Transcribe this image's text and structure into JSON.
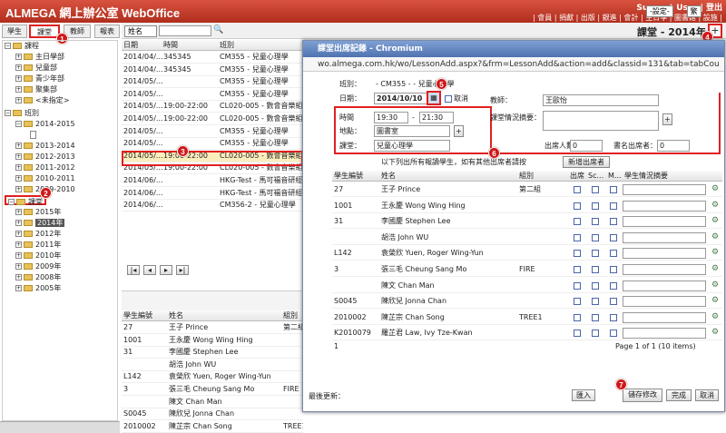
{
  "app": {
    "logo": "ALMEGA 網上辦公室 WebOffice"
  },
  "topbar": {
    "user": "Support User | 登出",
    "links": "| 會員 | 捐獻 | 出版 | 銀進 | 會計 | 主日學 | 圖書館 | 設施 |",
    "settings_select": "-設定-",
    "lang_select": "繁"
  },
  "left_tabs": [
    "學生",
    "課堂",
    "教師",
    "報表"
  ],
  "tree": {
    "items": [
      "課程",
      "主日學部",
      "兒童部",
      "青少年部",
      "聚集部",
      "<未指定>",
      "班別",
      "2014-2015",
      "2013-2014",
      "2012-2013",
      "2011-2012",
      "2010-2011",
      "2009-2010",
      "課堂",
      "2015年",
      "2014年",
      "2012年",
      "2011年",
      "2010年",
      "2009年",
      "2008年",
      "2005年"
    ]
  },
  "main": {
    "title": "課堂 - 2014年",
    "search_select": "姓名",
    "columns": [
      "日期",
      "時間",
      "班別"
    ],
    "rows": [
      [
        "2014/04/...",
        "345345",
        "CM355 - 兒童心理學"
      ],
      [
        "2014/04/...",
        "345345",
        "CM355 - 兒童心理學"
      ],
      [
        "2014/05/...",
        "",
        "CM355 - 兒童心理學"
      ],
      [
        "2014/05/...",
        "",
        "CM355 - 兒童心理學"
      ],
      [
        "2014/05/...",
        "19:00-22:00",
        "CL020-005 - 數會音樂組"
      ],
      [
        "2014/05/...",
        "19:00-22:00",
        "CL020-005 - 數會音樂組"
      ],
      [
        "2014/05/...",
        "",
        "CM355 - 兒童心理學"
      ],
      [
        "2014/05/...",
        "",
        "CM355 - 兒童心理學"
      ],
      [
        "2014/05/...",
        "19:00-22:00",
        "CL020-005 - 數會音樂組"
      ],
      [
        "2014/05/...",
        "19:00-22:00",
        "CL020-005 - 數會音樂組"
      ],
      [
        "2014/06/...",
        "",
        "HKG-Test - 馬可福音研經"
      ],
      [
        "2014/06/...",
        "",
        "HKG-Test - 馬可福音研經"
      ],
      [
        "2014/06/...",
        "",
        "CM356-2 - 兒童心理學"
      ]
    ],
    "bottom_columns": [
      "學生編號",
      "姓名",
      "組別"
    ],
    "bottom_rows": [
      [
        "27",
        "王子 Prince",
        "第二組"
      ],
      [
        "1001",
        "王永慶 Wong Wing Hing",
        ""
      ],
      [
        "31",
        "李國慶 Stephen Lee",
        ""
      ],
      [
        "",
        "胡浩 John WU",
        ""
      ],
      [
        "L142",
        "袁榮欣 Yuen, Roger Wing-Yun",
        ""
      ],
      [
        "3",
        "張三毛 Cheung Sang Mo",
        "FIRE"
      ],
      [
        "",
        "陳文 Chan Man",
        ""
      ],
      [
        "S0045",
        "陳欣兒 Jonna Chan",
        ""
      ],
      [
        "2010002",
        "陳芷宗 Chan Song",
        "TREE1"
      ]
    ]
  },
  "popup": {
    "title": "課堂出席記錄 - Chromium",
    "url": "wo.almega.com.hk/wo/LessonAdd.aspx?&frm=LessonAdd&action=add&classid=131&tab=tabCou",
    "class_label": "班別：",
    "class_value": "- CM355 - - 兒童心理學",
    "date_label": "日期：",
    "date_value": "2014/10/10",
    "cancel_label": "取消",
    "teacher_label": "教師：",
    "teacher_value": "王歐怡",
    "summary_label": "課堂情況摘要：",
    "time_label": "時間",
    "time_from": "19:30",
    "time_to": "21:30",
    "place_label": "地點：",
    "place_value": "圖書室",
    "lesson_label": "課堂：",
    "lesson_value": "兒童心理學",
    "attend_label": "出席人數：",
    "attend_value": "0",
    "guest_label": "書名出席者：",
    "guest_value": "0",
    "note": "以下列出所有報讀學生，如有其他出席者請按",
    "add_guest_btn": "新增出席者",
    "columns": [
      "學生編號",
      "姓名",
      "組別",
      "出席",
      "Sc...",
      "M...",
      "學生情況摘要"
    ],
    "rows": [
      [
        "27",
        "王子 Prince",
        "第二組"
      ],
      [
        "1001",
        "王永慶 Wong Wing Hing",
        ""
      ],
      [
        "31",
        "李國慶 Stephen Lee",
        ""
      ],
      [
        "",
        "胡浩 John WU",
        ""
      ],
      [
        "L142",
        "袁榮欣 Yuen, Roger Wing-Yun",
        ""
      ],
      [
        "3",
        "張三毛 Cheung Sang Mo",
        "FIRE"
      ],
      [
        "",
        "陳文 Chan Man",
        ""
      ],
      [
        "S0045",
        "陳欣兒 Jonna Chan",
        ""
      ],
      [
        "2010002",
        "陳芷宗 Chan Song",
        "TREE1"
      ],
      [
        "K2010079",
        "羅芷君 Law, Ivy Tze-Kwan",
        ""
      ]
    ],
    "page_left": "1",
    "page_info": "Page 1 of 1 (10 items)",
    "last_update": "最後更新：",
    "import_btn": "匯入",
    "save_btn": "儲存修改",
    "done_btn": "完成",
    "cancel_btn": "取消"
  },
  "badges": [
    "1",
    "2",
    "3",
    "4",
    "5",
    "6",
    "7"
  ],
  "colors": {
    "topbar": "#c23a26",
    "highlight": "#fbeebd",
    "callout": "#d01818",
    "popup_title": "#5a7cb8"
  }
}
